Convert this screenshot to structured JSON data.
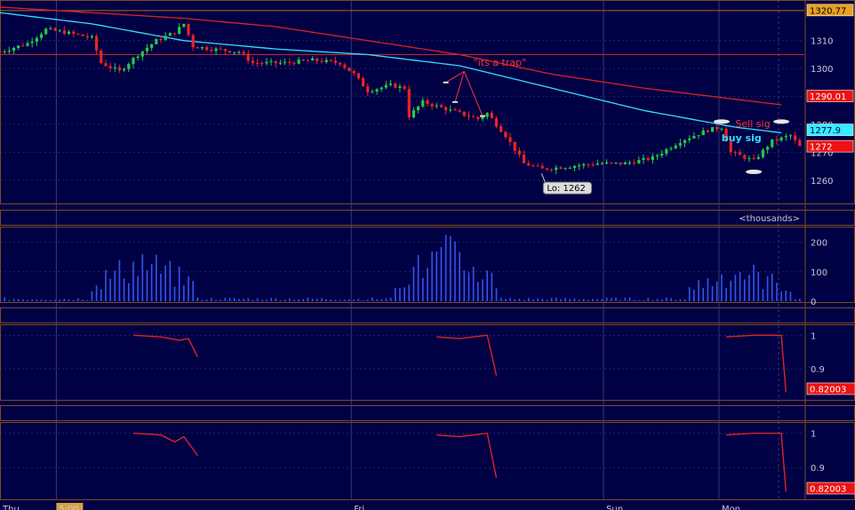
{
  "colors": {
    "background": "#000044",
    "panel_border": "#7a4a20",
    "grid": "#1c2a66",
    "up_candle": "#22cc44",
    "down_candle": "#ee2222",
    "ma_long": "#dd2222",
    "ma_short": "#33ddff",
    "volume": "#3355ee",
    "indicator": "#dd2222",
    "last_price_tag": "#ee1111",
    "high_tag": "#e8a020",
    "ma_short_tag": "#33eeff",
    "annotation_red": "#ff3333",
    "annotation_cyan": "#33ddff"
  },
  "time_axis": {
    "labels": [
      {
        "text": "Thu",
        "x": 0.0
      },
      {
        "text": "5:00",
        "x": 0.095,
        "highlight": true
      },
      {
        "text": "Fri",
        "x": 0.44
      },
      {
        "text": "Sun",
        "x": 0.735
      },
      {
        "text": "Mon",
        "x": 0.87
      }
    ]
  },
  "chart_data": [
    {
      "type": "candlestick",
      "panel": "price",
      "ylim": [
        1252,
        1322
      ],
      "yticks": [
        1260,
        1270,
        1280,
        1290,
        1300,
        1310
      ],
      "ytick_labels": [
        "1260",
        "1270",
        "1280",
        "1290",
        "1300",
        "1310"
      ],
      "x_range": [
        0,
        175
      ],
      "close_anchors": [
        [
          0,
          1306
        ],
        [
          6,
          1309
        ],
        [
          10,
          1314
        ],
        [
          14,
          1313
        ],
        [
          20,
          1311
        ],
        [
          22,
          1302
        ],
        [
          26,
          1299
        ],
        [
          30,
          1305
        ],
        [
          34,
          1310
        ],
        [
          38,
          1313
        ],
        [
          40,
          1316
        ],
        [
          42,
          1308
        ],
        [
          46,
          1307
        ],
        [
          52,
          1306
        ],
        [
          55,
          1302
        ],
        [
          62,
          1302
        ],
        [
          68,
          1303
        ],
        [
          74,
          1302
        ],
        [
          77,
          1298
        ],
        [
          80,
          1292
        ],
        [
          85,
          1294
        ],
        [
          88,
          1293
        ],
        [
          89,
          1283
        ],
        [
          92,
          1288
        ],
        [
          96,
          1286
        ],
        [
          100,
          1284
        ],
        [
          104,
          1282
        ],
        [
          106,
          1284
        ],
        [
          110,
          1276
        ],
        [
          114,
          1266
        ],
        [
          118,
          1264
        ],
        [
          124,
          1265
        ],
        [
          130,
          1266
        ],
        [
          136,
          1266
        ],
        [
          142,
          1268
        ],
        [
          148,
          1274
        ],
        [
          154,
          1278
        ],
        [
          157,
          1279
        ],
        [
          159,
          1270
        ],
        [
          164,
          1267
        ],
        [
          168,
          1274
        ],
        [
          172,
          1276
        ],
        [
          174,
          1272
        ]
      ],
      "ma_long_anchors": [
        [
          0,
          1322
        ],
        [
          20,
          1320
        ],
        [
          40,
          1318
        ],
        [
          60,
          1315
        ],
        [
          80,
          1310
        ],
        [
          100,
          1305
        ],
        [
          120,
          1298
        ],
        [
          140,
          1293
        ],
        [
          160,
          1289
        ],
        [
          170,
          1287
        ]
      ],
      "ma_short_anchors": [
        [
          0,
          1320
        ],
        [
          20,
          1316
        ],
        [
          40,
          1310
        ],
        [
          60,
          1307
        ],
        [
          80,
          1305
        ],
        [
          100,
          1301
        ],
        [
          120,
          1293
        ],
        [
          140,
          1285
        ],
        [
          160,
          1279
        ],
        [
          170,
          1277
        ]
      ],
      "levels": [
        {
          "name": "high",
          "value": 1320.77
        },
        {
          "name": "support",
          "value": 1305
        }
      ],
      "series_tags": [
        {
          "name": "high",
          "text": "1320.77",
          "value": 1320.77
        },
        {
          "name": "ma-long",
          "text": "1290.01",
          "value": 1290.01
        },
        {
          "name": "ma-short",
          "text": "1277.9",
          "value": 1277.9
        },
        {
          "name": "last",
          "text": "1272",
          "value": 1272
        }
      ],
      "annotations": [
        {
          "name": "its-a-trap",
          "text": "\"its a trap\"",
          "x": 103,
          "y": 1301,
          "color": "red"
        },
        {
          "name": "sell-signal",
          "text": "Sell sig",
          "x": 160,
          "y": 1279,
          "color": "red"
        },
        {
          "name": "buy-signal",
          "text": "buy sig",
          "x": 157,
          "y": 1274,
          "color": "cyan"
        },
        {
          "name": "low-callout",
          "text": "Lo: 1262",
          "x": 119,
          "y": 1258,
          "color": "white"
        }
      ],
      "trap_pointers": [
        [
          97,
          1295
        ],
        [
          99,
          1288
        ],
        [
          105,
          1283
        ]
      ],
      "trap_origin": [
        101,
        1299
      ],
      "signal_markers": [
        {
          "x": 157,
          "value": 1281
        },
        {
          "x": 164,
          "value": 1263
        },
        {
          "x": 170,
          "value": 1281
        }
      ]
    },
    {
      "type": "bar",
      "panel": "volume",
      "title": "<thousands>",
      "ylim": [
        0,
        250
      ],
      "yticks": [
        0,
        100,
        200
      ],
      "ytick_labels": [
        "0",
        "100",
        "200"
      ],
      "bursts": [
        {
          "start": 20,
          "end": 42,
          "peak": 180
        },
        {
          "start": 86,
          "end": 108,
          "peak": 215
        },
        {
          "start": 150,
          "end": 172,
          "peak": 140
        }
      ]
    },
    {
      "type": "line",
      "panel": "indicator-1",
      "ylim": [
        0.81,
        1.03
      ],
      "yticks": [
        0.9,
        1
      ],
      "ytick_labels": [
        "0.9",
        "1"
      ],
      "last_value": "0.82003",
      "segments": [
        [
          [
            29,
            1.0
          ],
          [
            35,
            0.995
          ],
          [
            39,
            0.985
          ],
          [
            41,
            0.99
          ],
          [
            43,
            0.935
          ]
        ],
        [
          [
            95,
            0.995
          ],
          [
            100,
            0.99
          ],
          [
            106,
            1.0
          ],
          [
            108,
            0.88
          ]
        ],
        [
          [
            158,
            0.995
          ],
          [
            164,
            1.0
          ],
          [
            170,
            1.0
          ],
          [
            171,
            0.83
          ]
        ]
      ]
    },
    {
      "type": "line",
      "panel": "indicator-2",
      "ylim": [
        0.81,
        1.03
      ],
      "yticks": [
        0.9,
        1
      ],
      "ytick_labels": [
        "0.9",
        "1"
      ],
      "last_value": "0.82003",
      "segments": [
        [
          [
            29,
            1.0
          ],
          [
            35,
            0.995
          ],
          [
            38,
            0.975
          ],
          [
            40,
            0.99
          ],
          [
            43,
            0.935
          ]
        ],
        [
          [
            95,
            0.995
          ],
          [
            100,
            0.99
          ],
          [
            106,
            1.0
          ],
          [
            108,
            0.87
          ]
        ],
        [
          [
            158,
            0.995
          ],
          [
            164,
            1.0
          ],
          [
            170,
            1.0
          ],
          [
            171,
            0.83
          ]
        ]
      ]
    }
  ]
}
